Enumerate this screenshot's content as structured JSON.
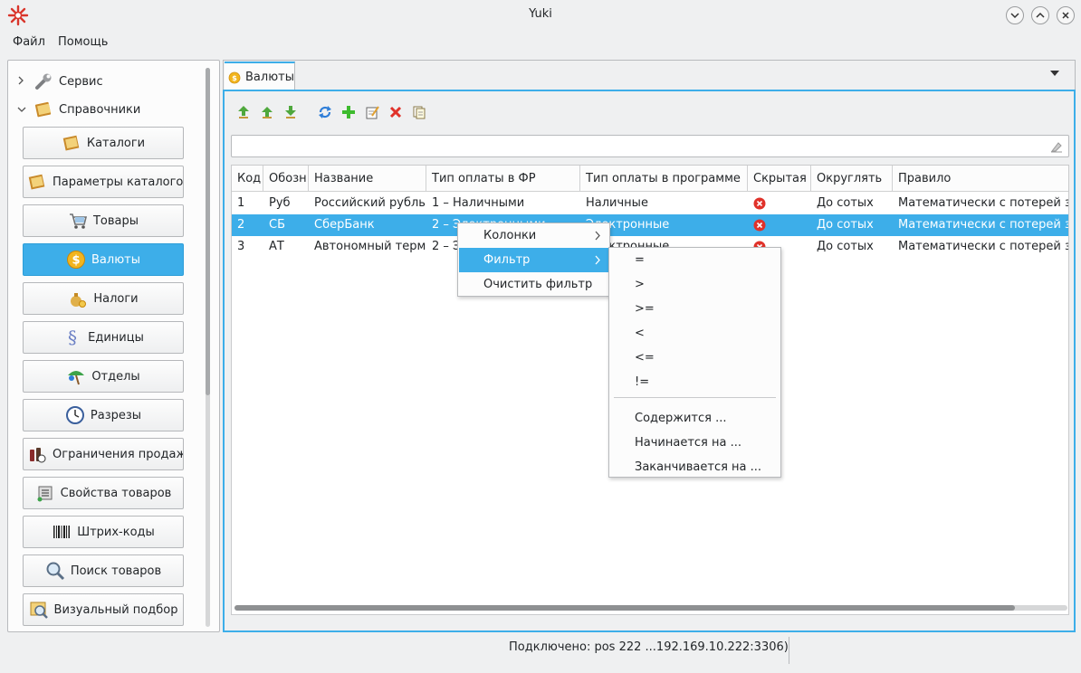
{
  "window": {
    "title": "Yuki"
  },
  "menubar": {
    "items": [
      "Файл",
      "Помощь"
    ]
  },
  "sidebar": {
    "groups": [
      {
        "label": "Сервис",
        "expanded": false,
        "icon": "wrench-icon"
      },
      {
        "label": "Справочники",
        "expanded": true,
        "icon": "book-icon"
      }
    ],
    "buttons": [
      {
        "label": "Каталоги",
        "icon": "catalog-icon"
      },
      {
        "label": "Параметры каталогов",
        "icon": "catalog-params-icon"
      },
      {
        "label": "Товары",
        "icon": "cart-icon"
      },
      {
        "label": "Валюты",
        "icon": "dollar-coin-icon",
        "active": true
      },
      {
        "label": "Налоги",
        "icon": "money-bag-icon"
      },
      {
        "label": "Единицы",
        "icon": "units-icon"
      },
      {
        "label": "Отделы",
        "icon": "departments-icon"
      },
      {
        "label": "Разрезы",
        "icon": "clock-icon"
      },
      {
        "label": "Ограничения продаж",
        "icon": "bottles-icon"
      },
      {
        "label": "Свойства товаров",
        "icon": "properties-icon"
      },
      {
        "label": "Штрих-коды",
        "icon": "barcode-icon"
      },
      {
        "label": "Поиск товаров",
        "icon": "magnifier-icon"
      },
      {
        "label": "Визуальный подбор",
        "icon": "visual-picker-icon"
      }
    ]
  },
  "tab": {
    "label": "Валюты",
    "icon": "dollar-coin-icon"
  },
  "toolbar": {
    "buttons": [
      "import-icon",
      "export-icon",
      "download-icon",
      "refresh-icon",
      "add-icon",
      "edit-icon",
      "delete-icon",
      "copy-icon"
    ]
  },
  "filter": {
    "value": ""
  },
  "table": {
    "columns": [
      "Код",
      "Обозн",
      "Название",
      "Тип оплаты в ФР",
      "Тип оплаты в программе",
      "Скрытая",
      "Округлять",
      "Правило"
    ],
    "rows": [
      {
        "code": "1",
        "abbr": "Руб",
        "name": "Российский рубль",
        "fr_type": "1 – Наличными",
        "prog_type": "Наличные",
        "hidden": false,
        "round": "До сотых",
        "rule": "Математически с потерей зн"
      },
      {
        "code": "2",
        "abbr": "СБ",
        "name": "СберБанк",
        "fr_type": "2 – Электронными",
        "prog_type": "Электронные",
        "hidden": false,
        "round": "До сотых",
        "rule": "Математически с потерей зн",
        "selected": true
      },
      {
        "code": "3",
        "abbr": "АТ",
        "name": "Автономный терми",
        "fr_type": "2 – Электронными",
        "prog_type": "Электронные",
        "hidden": false,
        "round": "До сотых",
        "rule": "Математически с потерей зн"
      }
    ]
  },
  "context_menu": {
    "items": [
      "Колонки",
      "Фильтр",
      "Очистить фильтр"
    ],
    "highlighted": "Фильтр",
    "submenu": {
      "operators": [
        "=",
        ">",
        ">=",
        "<",
        "<=",
        "!="
      ],
      "text_ops": [
        "Содержится ...",
        "Начинается на ...",
        "Заканчивается на ..."
      ]
    }
  },
  "status": {
    "text": "Подключено: pos 222 ...192.169.10.222:3306)"
  },
  "colors": {
    "accent": "#3daee9",
    "delete_red": "#e0322a",
    "add_green": "#3dbb2e"
  }
}
